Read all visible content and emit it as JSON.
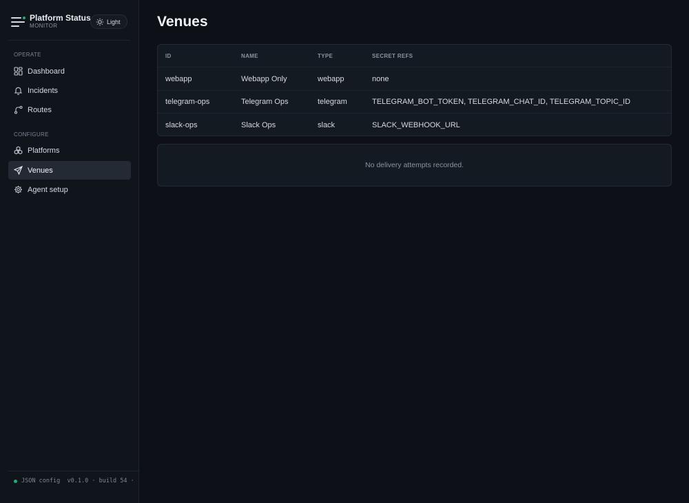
{
  "app": {
    "title": "Platform Status",
    "subtitle": "MONITOR"
  },
  "theme_toggle": {
    "label": "Light",
    "icon": "sun-icon"
  },
  "sidebar": {
    "sections": [
      {
        "label": "OPERATE",
        "items": [
          {
            "label": "Dashboard",
            "icon": "dashboard-icon"
          },
          {
            "label": "Incidents",
            "icon": "bell-icon"
          },
          {
            "label": "Routes",
            "icon": "route-icon"
          }
        ]
      },
      {
        "label": "CONFIGURE",
        "items": [
          {
            "label": "Platforms",
            "icon": "boxes-icon"
          },
          {
            "label": "Venues",
            "icon": "send-icon",
            "active": true
          },
          {
            "label": "Agent setup",
            "icon": "gear-icon"
          }
        ]
      }
    ],
    "footer": "JSON config  v0.1.0 · build 54 ·",
    "footer_status_color": "#1fae7e"
  },
  "main": {
    "title": "Venues",
    "table": {
      "columns": [
        "ID",
        "NAME",
        "TYPE",
        "SECRET REFS"
      ],
      "rows": [
        [
          "webapp",
          "Webapp Only",
          "webapp",
          "none"
        ],
        [
          "telegram-ops",
          "Telegram Ops",
          "telegram",
          "TELEGRAM_BOT_TOKEN, TELEGRAM_CHAT_ID, TELEGRAM_TOPIC_ID"
        ],
        [
          "slack-ops",
          "Slack Ops",
          "slack",
          "SLACK_WEBHOOK_URL"
        ]
      ]
    },
    "empty_state": "No delivery attempts recorded."
  },
  "colors": {
    "background": "#0d1117",
    "sidebar": "#10151c",
    "card": "#141a21",
    "active_nav": "#232a33"
  }
}
